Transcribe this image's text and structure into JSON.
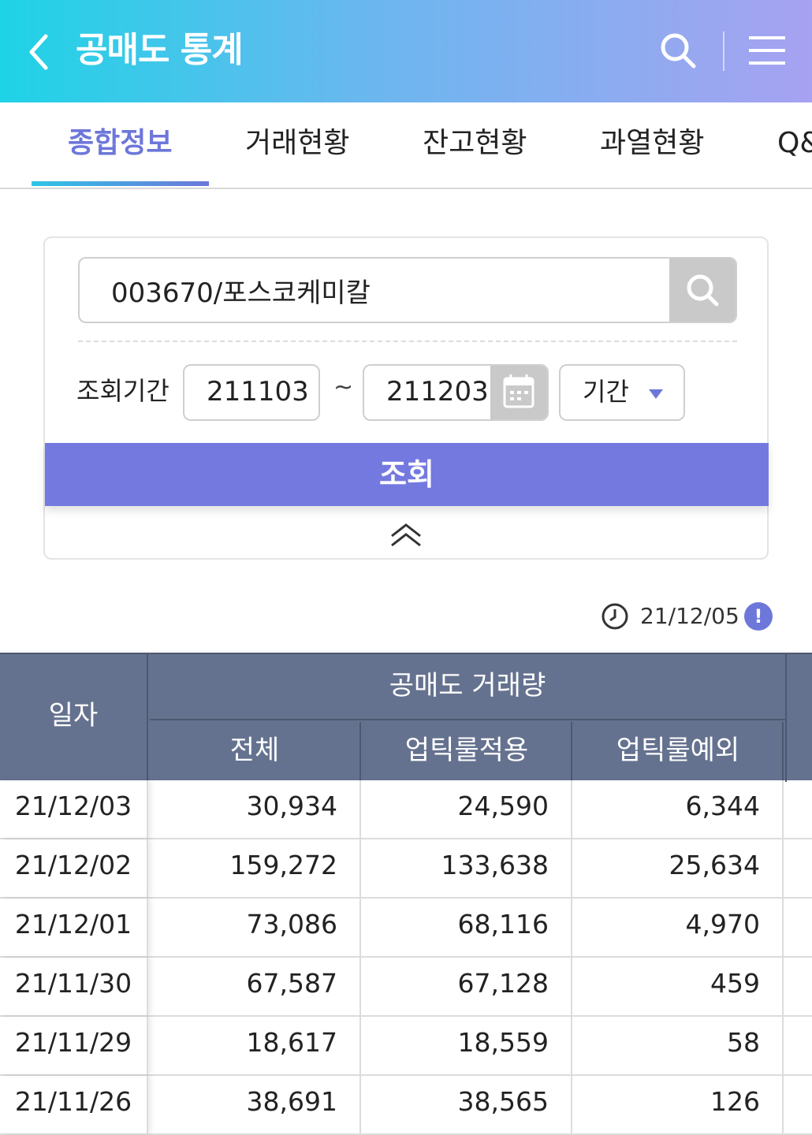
{
  "header": {
    "title": "공매도 통계",
    "back_icon": "chevron-left-icon",
    "search_icon": "search-icon",
    "menu_icon": "hamburger-menu-icon"
  },
  "tabs": [
    {
      "label": "종합정보",
      "active": true
    },
    {
      "label": "거래현황",
      "active": false
    },
    {
      "label": "잔고현황",
      "active": false
    },
    {
      "label": "과열현황",
      "active": false
    },
    {
      "label": "Q&",
      "active": false
    }
  ],
  "search": {
    "stock_value": "003670/포스코케미칼",
    "period_label": "조회기간",
    "start_date": "211103",
    "separator": "~",
    "end_date": "211203",
    "period_select": "기간",
    "query_button": "조회"
  },
  "timestamp": "21/12/05",
  "table": {
    "col_date": "일자",
    "group_header": "공매도 거래량",
    "sub_headers": [
      "전체",
      "업틱룰적용",
      "업틱룰예외"
    ],
    "rows": [
      {
        "date": "21/12/03",
        "total": "30,934",
        "uptick": "24,590",
        "except": "6,344"
      },
      {
        "date": "21/12/02",
        "total": "159,272",
        "uptick": "133,638",
        "except": "25,634"
      },
      {
        "date": "21/12/01",
        "total": "73,086",
        "uptick": "68,116",
        "except": "4,970"
      },
      {
        "date": "21/11/30",
        "total": "67,587",
        "uptick": "67,128",
        "except": "459"
      },
      {
        "date": "21/11/29",
        "total": "18,617",
        "uptick": "18,559",
        "except": "58"
      },
      {
        "date": "21/11/26",
        "total": "38,691",
        "uptick": "38,565",
        "except": "126"
      }
    ]
  },
  "colors": {
    "accent": "#6d77da",
    "header_gradient_start": "#1ed3e6",
    "header_gradient_end": "#a7a2f1",
    "table_header": "#65728f",
    "query_button": "#7479e0"
  }
}
